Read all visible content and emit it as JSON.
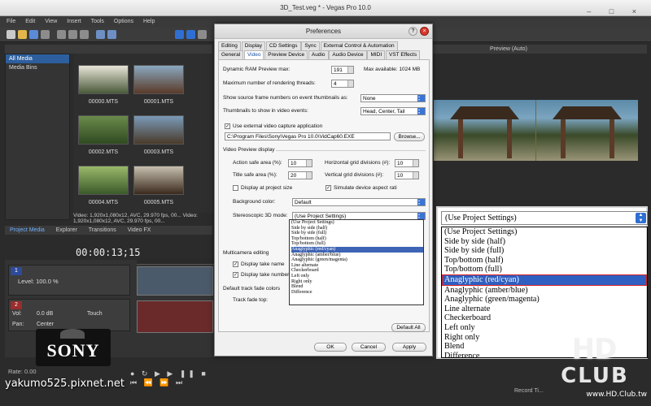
{
  "window": {
    "title": "3D_Test.veg * - Vegas Pro 10.0"
  },
  "menu": [
    "File",
    "Edit",
    "View",
    "Insert",
    "Tools",
    "Options",
    "Help"
  ],
  "media": {
    "tree": [
      "All Media",
      "Media Bins"
    ],
    "thumbs": [
      "00000.MTS",
      "00001.MTS",
      "00002.MTS",
      "00003.MTS",
      "00004.MTS",
      "00005.MTS"
    ],
    "info": "Video: 1,920x1,080x12, AVC, 29.970 fps, 00... Video: 1,920x1,080x12, AVC, 29.970 fps, 00...",
    "tabs": [
      "Project Media",
      "Explorer",
      "Transitions",
      "Video FX"
    ]
  },
  "preview": {
    "mode": "Preview (Auto)"
  },
  "timeline": {
    "timecode": "00:00:13;15",
    "level": "Level: 100.0 %",
    "audio_vol": "Vol:",
    "audio_vol_value": "0.0 dB",
    "audio_pan": "Pan:",
    "audio_pan_value": "Center",
    "touch": "Touch",
    "rate": "Rate: 0.00",
    "record_time": "Record Ti..."
  },
  "prefs": {
    "title": "Preferences",
    "tabs_row1": [
      "Editing",
      "Display",
      "CD Settings",
      "Sync",
      "External Control & Automation"
    ],
    "tabs_row2": [
      "General",
      "Video",
      "Preview Device",
      "Audio",
      "Audio Device",
      "MIDI",
      "VST Effects"
    ],
    "active_tab": "Video",
    "ram_label": "Dynamic RAM Preview max:",
    "ram_value": "191",
    "ram_max": "Max available: 1024 MB",
    "threads_label": "Maximum number of rendering threads:",
    "threads_value": "4",
    "frame_numbers_label": "Show source frame numbers on event thumbnails as:",
    "frame_numbers_value": "None",
    "thumbnails_label": "Thumbnails to show in video events:",
    "thumbnails_value": "Head, Center, Tail",
    "external_app_check": "Use external video capture application",
    "external_app_path": "C:\\Program Files\\Sony\\Vegas Pro 10.0\\VidCap60.EXE",
    "browse": "Browse...",
    "preview_display": "Video Preview display",
    "action_safe_label": "Action safe area (%):",
    "action_safe_value": "10",
    "title_safe_label": "Title safe area (%):",
    "title_safe_value": "20",
    "hgrid_label": "Horizontal grid divisions (#):",
    "hgrid_value": "10",
    "vgrid_label": "Vertical grid divisions (#):",
    "vgrid_value": "10",
    "display_project_size": "Display at project size",
    "simulate_aspect": "Simulate device aspect rati",
    "background_label": "Background color:",
    "background_value": "Default",
    "stereo_label": "Stereoscopic 3D mode:",
    "stereo_value": "Use Project Settings",
    "multicam": "Multicamera editing",
    "take_name": "Display take name",
    "take_number": "Display take number",
    "fade_colors": "Default track fade colors",
    "fade_top": "Track fade top:",
    "default_all": "Default All",
    "ok": "OK",
    "cancel": "Cancel",
    "apply": "Apply"
  },
  "stereo_options": [
    "(Use Project Settings)",
    "Side by side (half)",
    "Side by side (full)",
    "Top/bottom (half)",
    "Top/bottom (full)",
    "Anaglyphic (red/cyan)",
    "Anaglyphic (amber/blue)",
    "Anaglyphic (green/magenta)",
    "Line alternate",
    "Checkerboard",
    "Left only",
    "Right only",
    "Blend",
    "Difference"
  ],
  "zoom": {
    "selected": "(Use Project Settings)",
    "highlighted_index": 5
  },
  "watermarks": {
    "sony": "SONY",
    "blog": "yakumo525.pixnet.net",
    "hd": "HD",
    "club": "CLUB",
    "url": "www.HD.Club.tw"
  },
  "colors": {
    "highlight": "#2f5fc0",
    "outline": "#d22222"
  }
}
